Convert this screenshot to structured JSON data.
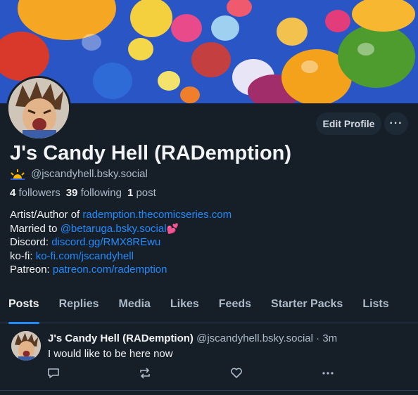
{
  "profile": {
    "display_name": "J's Candy Hell (RADemption)",
    "handle": "@jscandyhell.bsky.social",
    "stats": {
      "followers_count": "4",
      "followers_label": "followers",
      "following_count": "39",
      "following_label": "following",
      "posts_count": "1",
      "posts_label": "post"
    },
    "edit_label": "Edit Profile",
    "more_label": "···"
  },
  "bio": {
    "line1_prefix": "Artist/Author of ",
    "line1_link": "rademption.thecomicseries.com",
    "line2_prefix": "Married to ",
    "line2_link": "@betaruga.bsky.social",
    "line2_emoji": "💕",
    "line3_prefix": "Discord: ",
    "line3_link": "discord.gg/RMX8REwu",
    "line4_prefix": "ko-fi: ",
    "line4_link": "ko-fi.com/jscandyhell",
    "line5_prefix": "Patreon: ",
    "line5_link": "patreon.com/rademption"
  },
  "tabs": [
    {
      "label": "Posts",
      "active": true
    },
    {
      "label": "Replies"
    },
    {
      "label": "Media"
    },
    {
      "label": "Likes"
    },
    {
      "label": "Feeds"
    },
    {
      "label": "Starter Packs"
    },
    {
      "label": "Lists"
    }
  ],
  "post": {
    "author_name": "J's Candy Hell (RADemption)",
    "author_handle": "@jscandyhell.bsky.social",
    "separator": "·",
    "time": "3m",
    "text": "I would like to be here now"
  },
  "colors": {
    "background": "#161e27",
    "accent": "#208bfe",
    "muted": "#aebbc9",
    "heart": "#ff3d8b"
  },
  "icons": {
    "handle_badge": "sun-icon",
    "reply": "reply-icon",
    "repost": "repost-icon",
    "like": "heart-icon",
    "more": "more-icon"
  }
}
